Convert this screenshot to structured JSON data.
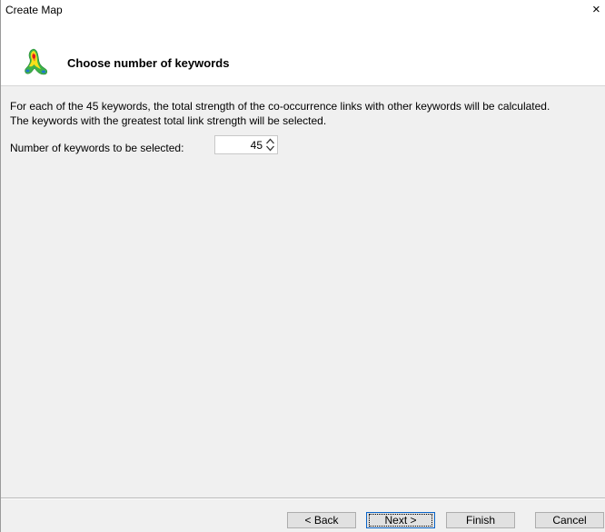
{
  "window": {
    "title": "Create Map",
    "close_glyph": "×"
  },
  "header": {
    "title": "Choose number of keywords",
    "icon": "vosviewer-heatmap-icon"
  },
  "body": {
    "description_line1": "For each of the 45 keywords, the total strength of the co-occurrence links with other keywords will be calculated.",
    "description_line2": "The keywords with the greatest total link strength will be selected.",
    "number_label": "Number of keywords to be selected:",
    "number_value": "45"
  },
  "buttons": {
    "back": "< Back",
    "next": "Next >",
    "finish": "Finish",
    "cancel": "Cancel"
  }
}
